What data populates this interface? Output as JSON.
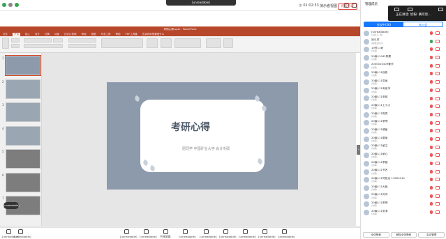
{
  "top": {
    "title_banner": "[unreadable]",
    "timer": "01:02:53",
    "view_mode": "演示者视图",
    "icons": [
      "signal-icon",
      "shield-icon",
      "status-icon"
    ]
  },
  "ppt": {
    "window_title": "考研心得.pptx - PowerPoint",
    "menu": [
      "文件",
      "开始",
      "插入",
      "设计",
      "切换",
      "动画",
      "幻灯片放映",
      "审阅",
      "视图",
      "开发工具",
      "帮助",
      "PDF工具集",
      "告诉我你想要做什么"
    ],
    "active_menu": "开始",
    "slide_numbers": [
      "1",
      "2",
      "3",
      "4",
      "5",
      "6",
      "7"
    ],
    "slide_title": "考研心得",
    "slide_subtitle": "屈同学 中国矿业大学 会计专硕",
    "status_left": "幻灯片 第 1 张，共 13 张",
    "status_right": "[unreadable]",
    "float_label": "[unreadable]"
  },
  "bottom_bar": {
    "items": [
      "[unreadable]",
      "[unreadable]",
      "[unreadable]",
      "[unreadable]",
      "共享屏幕",
      "[unreadable]",
      "[unreadable]",
      "[unreadable]",
      "[unreadable]",
      "[unreadable]",
      "[unreadable]"
    ],
    "leave_label": "结束会议"
  },
  "panel": {
    "header": "管理成员",
    "popup_text": "正在讲话: 奶粉: 赛可欣...",
    "tabs": [
      "会议中(26)",
      "未入会"
    ],
    "active_tab": 0,
    "participants": [
      {
        "name": "[unreadable]",
        "sub": "(主持人, 我)"
      },
      {
        "name": "屈可欣",
        "sub": "(联席主持人)"
      },
      {
        "name": "19考11研",
        "sub": "(访客)"
      },
      {
        "name": "20级11042陈期",
        "sub": "(访客)"
      },
      {
        "name": "2000010409曹亦",
        "sub": "(访客)"
      },
      {
        "name": "20级111段彬",
        "sub": "(访客)"
      },
      {
        "name": "20级111简丽",
        "sub": "(访客)"
      },
      {
        "name": "20级111周家萍",
        "sub": "(访客)"
      },
      {
        "name": "20级111张斌",
        "sub": "(访客)"
      },
      {
        "name": "20级111王小天",
        "sub": "(访客)"
      },
      {
        "name": "20级111陈昊",
        "sub": "(访客)"
      },
      {
        "name": "20级111李明",
        "sub": "(访客)"
      },
      {
        "name": "20级111晓星",
        "sub": "(访客)"
      },
      {
        "name": "20级111雷丽",
        "sub": "(访客)"
      },
      {
        "name": "20级111星尘",
        "sub": "(访客)"
      },
      {
        "name": "20级111星心",
        "sub": "(访客)"
      },
      {
        "name": "20级111李建",
        "sub": "(访客)"
      },
      {
        "name": "20级111书名",
        "sub": "(访客)"
      },
      {
        "name": "20级111何思远 17602014",
        "sub": "(访客)"
      },
      {
        "name": "20级111天磊",
        "sub": "(访客)"
      },
      {
        "name": "20级111刘洋",
        "sub": "(访客)"
      },
      {
        "name": "20级111明明",
        "sub": "(访客)"
      },
      {
        "name": "20级111张涛",
        "sub": "(访客)"
      }
    ],
    "bottom_buttons": [
      "全体静音",
      "解除全体静音",
      "会议管理"
    ]
  },
  "colors": {
    "ppt_red": "#b7472a",
    "slide_bg": "#8c9aab",
    "accent_blue": "#1677ff"
  }
}
